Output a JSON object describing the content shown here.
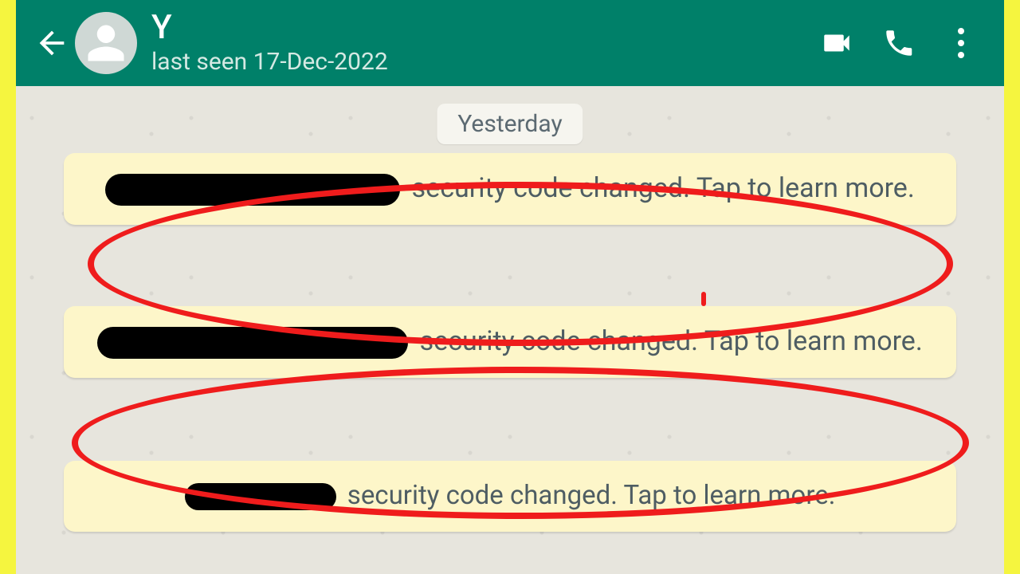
{
  "header": {
    "contactName": "Y",
    "lastSeen": "last seen 17-Dec-2022"
  },
  "chat": {
    "dateLabel": "Yesterday",
    "systemMessages": [
      {
        "visibleText": "security code changed. Tap to learn more.",
        "redacted": true
      },
      {
        "visibleText": "security code changed. Tap to learn more.",
        "redacted": true
      },
      {
        "visibleText": "security code changed. Tap to learn more.",
        "redacted": true
      }
    ]
  },
  "annotations": {
    "circledMessages": [
      0,
      1
    ]
  }
}
